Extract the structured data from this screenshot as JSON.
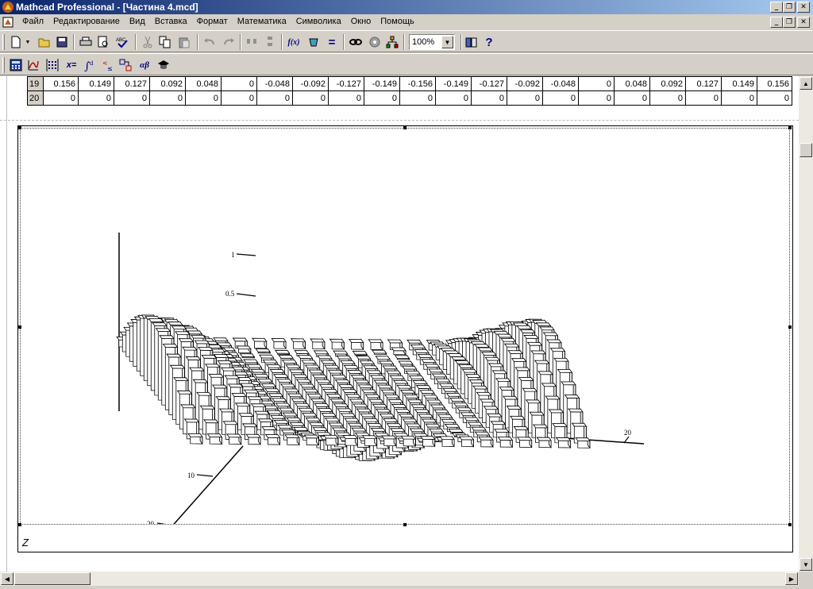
{
  "window": {
    "title": "Mathcad Professional - [Частина 4.mcd]",
    "minimize_label": "_",
    "restore_label": "❐",
    "close_label": "✕"
  },
  "menu": {
    "items": [
      "Файл",
      "Редактирование",
      "Вид",
      "Вставка",
      "Формат",
      "Математика",
      "Символика",
      "Окно",
      "Помощь"
    ]
  },
  "toolbar": {
    "zoom_value": "100%",
    "function_label": "f(x)",
    "equals_label": "=",
    "evaluate_label": "x=",
    "greek_label": "αβ"
  },
  "matrix": {
    "rows": [
      {
        "index": "19",
        "values": [
          "0.156",
          "0.149",
          "0.127",
          "0.092",
          "0.048",
          "0",
          "-0.048",
          "-0.092",
          "-0.127",
          "-0.149",
          "-0.156",
          "-0.149",
          "-0.127",
          "-0.092",
          "-0.048",
          "0",
          "0.048",
          "0.092",
          "0.127",
          "0.149",
          "0.156"
        ]
      },
      {
        "index": "20",
        "values": [
          "0",
          "0",
          "0",
          "0",
          "0",
          "0",
          "0",
          "0",
          "0",
          "0",
          "0",
          "0",
          "0",
          "0",
          "0",
          "0",
          "0",
          "0",
          "0",
          "0",
          "0"
        ]
      }
    ]
  },
  "chart_data": {
    "type": "bar3d",
    "title": "",
    "surface_label": "Z",
    "z_ticks": [
      "1",
      "0.5"
    ],
    "x_ticks": [
      "10",
      "20"
    ],
    "y_ticks": [
      "20"
    ],
    "grid_size": [
      21,
      21
    ],
    "z_range": [
      -0.5,
      1
    ]
  }
}
